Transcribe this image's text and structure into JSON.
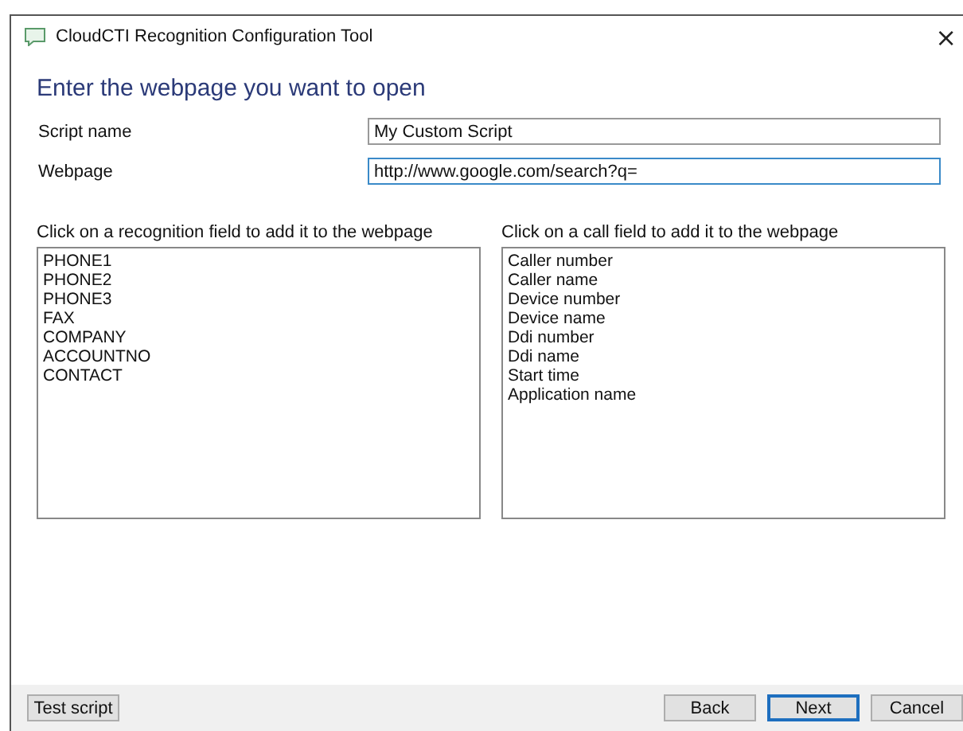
{
  "window": {
    "title": "CloudCTI Recognition Configuration Tool",
    "close": "×"
  },
  "heading": "Enter the webpage you want to open",
  "fields": [
    {
      "label": "Script name",
      "value": "My Custom Script",
      "focused": false
    },
    {
      "label": "Webpage",
      "value": "http://www.google.com/search?q=",
      "focused": true
    }
  ],
  "lists": [
    {
      "label": "Click on a recognition field to add it to the webpage",
      "items": [
        "PHONE1",
        "PHONE2",
        "PHONE3",
        "FAX",
        "COMPANY",
        "ACCOUNTNO",
        "CONTACT"
      ]
    },
    {
      "label": "Click on a call field to add it to the webpage",
      "items": [
        "Caller number",
        "Caller name",
        "Device number",
        "Device name",
        "Ddi number",
        "Ddi name",
        "Start time",
        "Application name"
      ]
    }
  ],
  "footer": {
    "left_buttons": [
      {
        "label": "Test script",
        "default": false
      }
    ],
    "right_buttons": [
      {
        "label": "Back",
        "default": false
      },
      {
        "label": "Next",
        "default": true
      },
      {
        "label": "Cancel",
        "default": false
      }
    ]
  }
}
